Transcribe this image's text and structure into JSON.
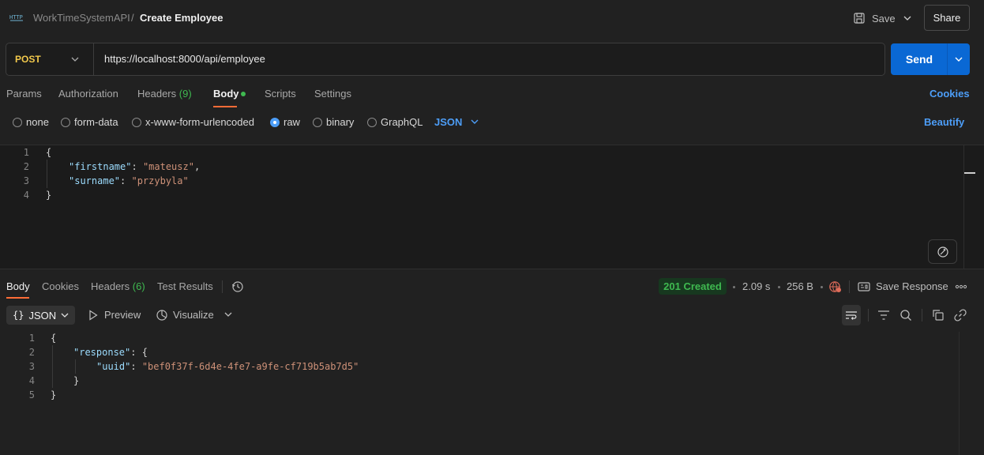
{
  "header": {
    "collection": "WorkTimeSystemAPI",
    "separator": "/",
    "request_name": "Create Employee",
    "save_label": "Save",
    "share_label": "Share"
  },
  "request": {
    "method": "POST",
    "url": "https://localhost:8000/api/employee",
    "send_label": "Send"
  },
  "request_tabs": {
    "params": "Params",
    "authorization": "Authorization",
    "headers": "Headers",
    "headers_count": "(9)",
    "body": "Body",
    "scripts": "Scripts",
    "settings": "Settings",
    "cookies": "Cookies"
  },
  "body_types": {
    "none": "none",
    "form_data": "form-data",
    "urlencoded": "x-www-form-urlencoded",
    "raw": "raw",
    "binary": "binary",
    "graphql": "GraphQL",
    "selected_format": "JSON",
    "beautify": "Beautify"
  },
  "request_body": {
    "line_numbers": [
      "1",
      "2",
      "3",
      "4"
    ],
    "open": "{",
    "close": "}",
    "firstname_key": "\"firstname\"",
    "firstname_value": "\"mateusz\"",
    "surname_key": "\"surname\"",
    "surname_value": "\"przybyla\""
  },
  "response_tabs": {
    "body": "Body",
    "cookies": "Cookies",
    "headers": "Headers",
    "headers_count": "(6)",
    "test_results": "Test Results"
  },
  "response_meta": {
    "status": "201 Created",
    "time": "2.09 s",
    "size": "256 B",
    "save_response": "Save Response",
    "status_color": "#3fb950"
  },
  "response_toolbar": {
    "format": "JSON",
    "preview": "Preview",
    "visualize": "Visualize"
  },
  "response_body": {
    "line_numbers": [
      "1",
      "2",
      "3",
      "4",
      "5"
    ],
    "open": "{",
    "response_key": "\"response\"",
    "inner_open": "{",
    "uuid_key": "\"uuid\"",
    "uuid_value": "\"bef0f37f-6d4e-4fe7-a9fe-cf719b5ab7d5\"",
    "inner_close": "}",
    "close": "}"
  },
  "colors": {
    "accent": "#ff6c37",
    "send_button": "#0a68d4",
    "link_blue": "#4d9ef8",
    "method_post": "#f2c94c"
  }
}
